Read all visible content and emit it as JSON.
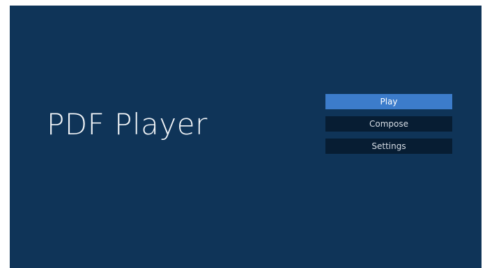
{
  "app": {
    "title": "PDF Player"
  },
  "menu": {
    "selected": "Play",
    "items": [
      {
        "label": "Play"
      },
      {
        "label": "Compose"
      },
      {
        "label": "Settings"
      }
    ]
  },
  "colors": {
    "background": "#0f3458",
    "item_default": "#071d33",
    "item_selected": "#3c7ccb"
  }
}
